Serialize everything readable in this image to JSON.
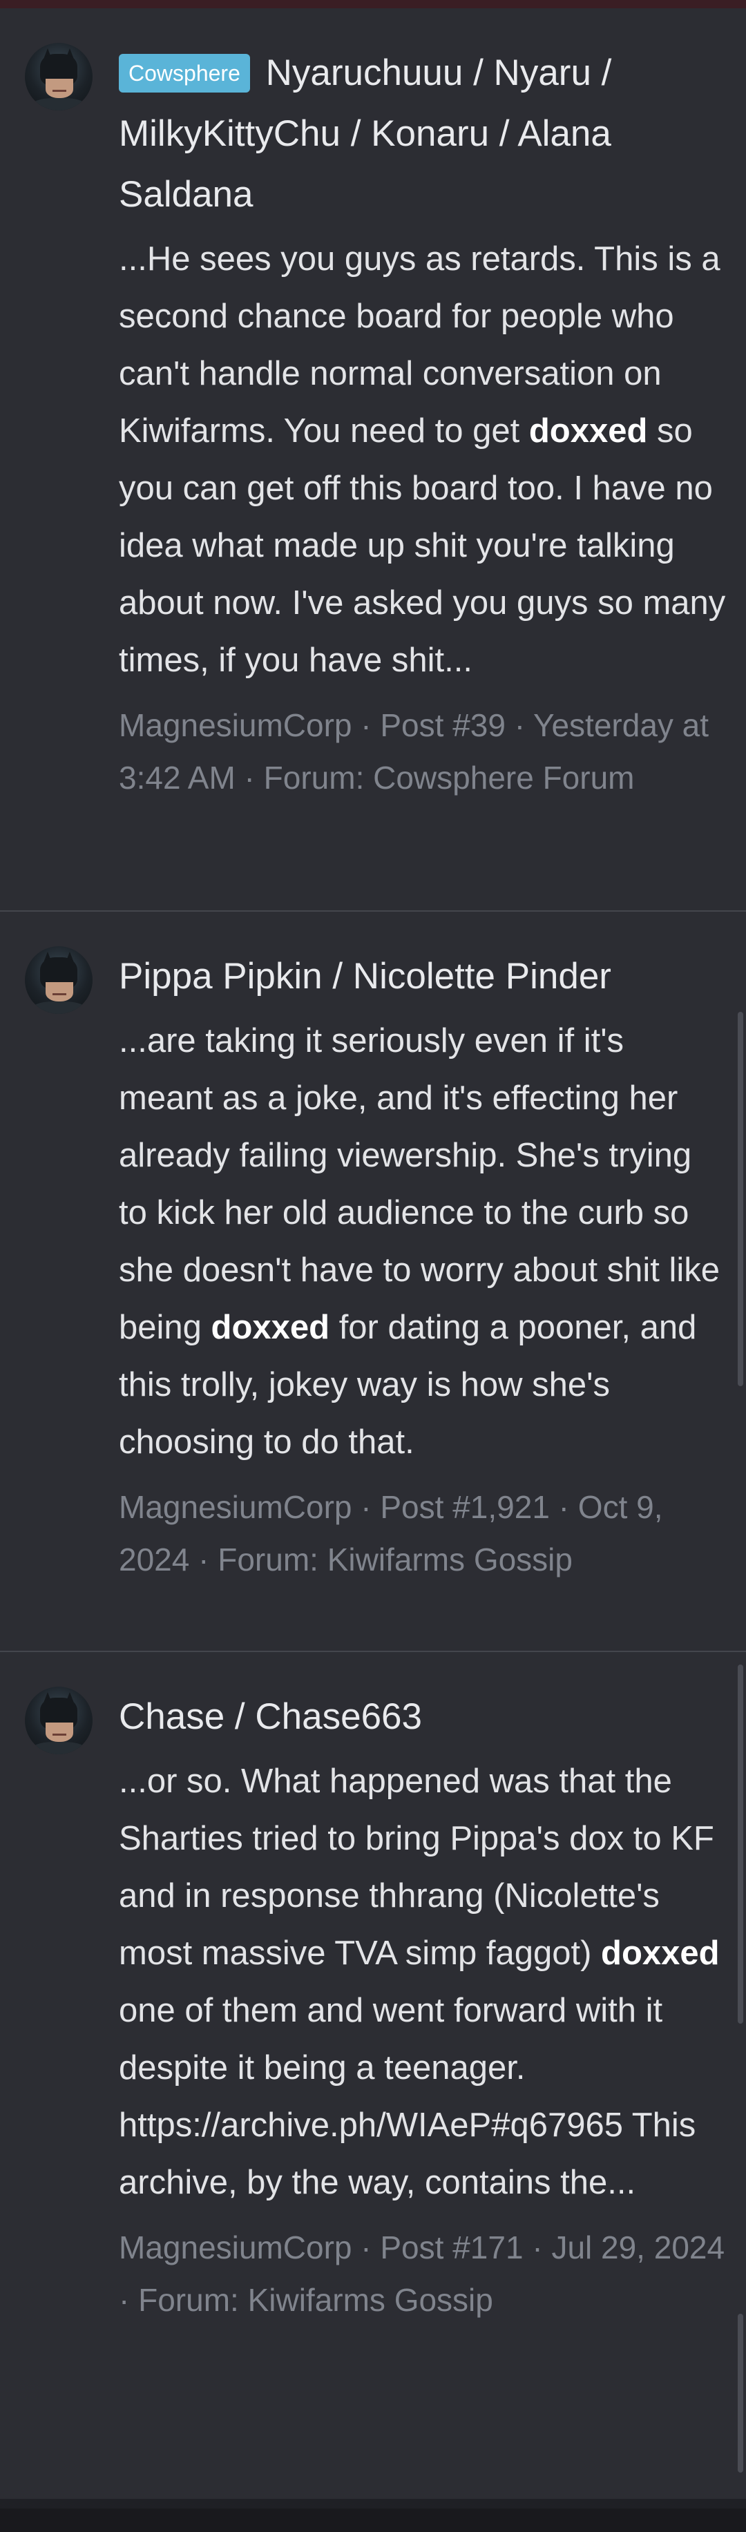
{
  "results": [
    {
      "prefix_badge": "Cowsphere",
      "title": "Nyaruchuuu / Nyaru / MilkyKittyChu / Konaru / Alana Saldana",
      "snippet_before": "...He sees you guys as retards. This is a second chance board for people who can't handle normal conversation on Kiwifarms. You need to get ",
      "snippet_highlight": "doxxed",
      "snippet_after": " so you can get off this board too. I have no idea what made up shit you're talking about now. I've asked you guys so many times, if you have shit...",
      "author": "MagnesiumCorp",
      "post": "Post #39",
      "date": "Yesterday at 3:42 AM",
      "forum": "Forum: Cowsphere Forum"
    },
    {
      "prefix_badge": "",
      "title": "Pippa Pipkin / Nicolette Pinder",
      "snippet_before": "...are taking it seriously even if it's meant as a joke, and it's effecting her already failing viewership. She's trying to kick her old audience to the curb so she doesn't have to worry about shit like being ",
      "snippet_highlight": "doxxed",
      "snippet_after": " for dating a pooner, and this trolly, jokey way is how she's choosing to do that.",
      "author": "MagnesiumCorp",
      "post": "Post #1,921",
      "date": "Oct 9, 2024",
      "forum": "Forum: Kiwifarms Gossip"
    },
    {
      "prefix_badge": "",
      "title": "Chase / Chase663",
      "snippet_before": "...or so. What happened was that the Sharties tried to bring Pippa's dox to KF and in response thhrang (Nicolette's most massive TVA simp faggot) ",
      "snippet_highlight": "doxxed",
      "snippet_after": " one of them and went forward with it despite it being a teenager. https://archive.ph/WIAeP#q67965 This archive, by the way, contains the...",
      "author": "MagnesiumCorp",
      "post": "Post #171",
      "date": "Jul 29, 2024",
      "forum": "Forum: Kiwifarms Gossip"
    }
  ],
  "separator": " · ",
  "colors": {
    "background": "#2c2d33",
    "badge": "#5ab4d8",
    "meta": "#80848d",
    "text": "#e3e4e7"
  }
}
